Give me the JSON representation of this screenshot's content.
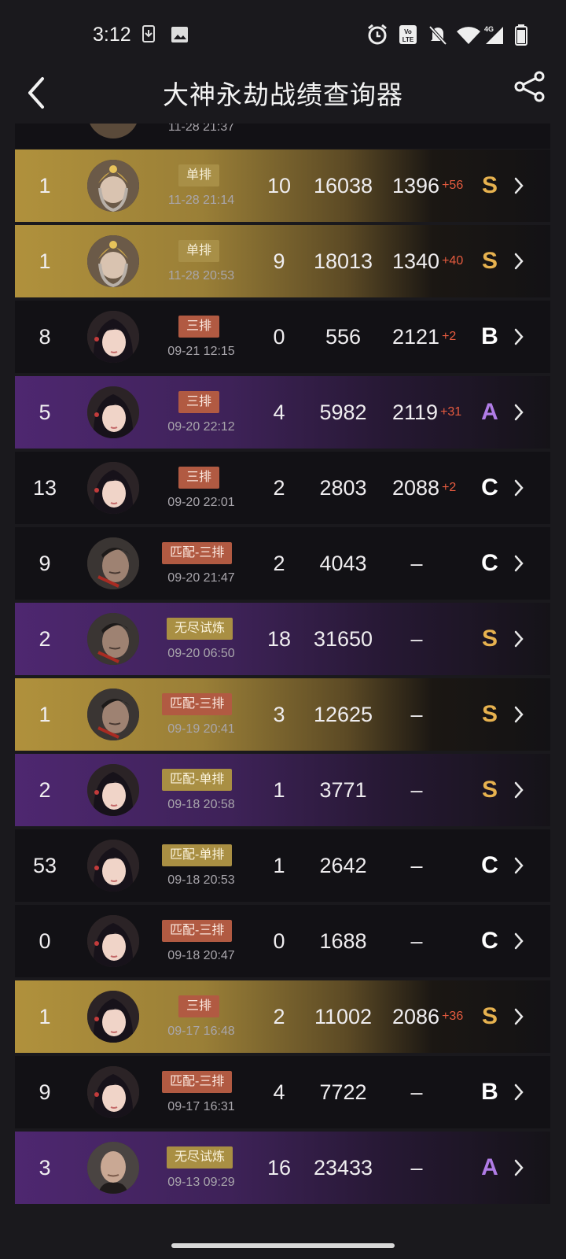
{
  "status_bar": {
    "time": "3:12",
    "icons": [
      "download-icon",
      "gallery-icon",
      "alarm-icon",
      "volte-icon",
      "mute-icon",
      "wifi-icon",
      "signal-4g-icon",
      "battery-icon"
    ],
    "network_label": "4G",
    "volte_label": "Vo LTE"
  },
  "header": {
    "title": "大神永劫战绩查询器"
  },
  "colors": {
    "gold_row": "#b0913c",
    "purple_row": "#4e2770",
    "dark_row": "#121115",
    "grade_s": "#e7b24f",
    "grade_a": "#b07ce6",
    "grade_bc": "#ffffff",
    "delta": "#e65b3f"
  },
  "partial_row": {
    "date": "11-28 21:37"
  },
  "matches": [
    {
      "rank": "1",
      "avatar": "warrior-crown",
      "mode": "单排",
      "mode_style": "gold",
      "date": "11-28 21:14",
      "kills": "10",
      "score": "16038",
      "rating": "1396",
      "delta": "+56",
      "grade": "S",
      "row_style": "gold"
    },
    {
      "rank": "1",
      "avatar": "warrior-crown",
      "mode": "单排",
      "mode_style": "gold",
      "date": "11-28 20:53",
      "kills": "9",
      "score": "18013",
      "rating": "1340",
      "delta": "+40",
      "grade": "S",
      "row_style": "gold"
    },
    {
      "rank": "8",
      "avatar": "girl",
      "mode": "三排",
      "mode_style": "red",
      "date": "09-21 12:15",
      "kills": "0",
      "score": "556",
      "rating": "2121",
      "delta": "+2",
      "grade": "B",
      "row_style": "dark"
    },
    {
      "rank": "5",
      "avatar": "girl",
      "mode": "三排",
      "mode_style": "red",
      "date": "09-20 22:12",
      "kills": "4",
      "score": "5982",
      "rating": "2119",
      "delta": "+31",
      "grade": "A",
      "row_style": "purple"
    },
    {
      "rank": "13",
      "avatar": "girl",
      "mode": "三排",
      "mode_style": "red",
      "date": "09-20 22:01",
      "kills": "2",
      "score": "2803",
      "rating": "2088",
      "delta": "+2",
      "grade": "C",
      "row_style": "dark"
    },
    {
      "rank": "9",
      "avatar": "man",
      "mode": "匹配-三排",
      "mode_style": "red",
      "date": "09-20 21:47",
      "kills": "2",
      "score": "4043",
      "rating": "–",
      "delta": "",
      "grade": "C",
      "row_style": "dark"
    },
    {
      "rank": "2",
      "avatar": "man",
      "mode": "无尽试炼",
      "mode_style": "olive",
      "date": "09-20 06:50",
      "kills": "18",
      "score": "31650",
      "rating": "–",
      "delta": "",
      "grade": "S",
      "row_style": "purple"
    },
    {
      "rank": "1",
      "avatar": "man",
      "mode": "匹配-三排",
      "mode_style": "red",
      "date": "09-19 20:41",
      "kills": "3",
      "score": "12625",
      "rating": "–",
      "delta": "",
      "grade": "S",
      "row_style": "gold"
    },
    {
      "rank": "2",
      "avatar": "girl",
      "mode": "匹配-单排",
      "mode_style": "olive",
      "date": "09-18 20:58",
      "kills": "1",
      "score": "3771",
      "rating": "–",
      "delta": "",
      "grade": "S",
      "row_style": "purple"
    },
    {
      "rank": "53",
      "avatar": "girl",
      "mode": "匹配-单排",
      "mode_style": "olive",
      "date": "09-18 20:53",
      "kills": "1",
      "score": "2642",
      "rating": "–",
      "delta": "",
      "grade": "C",
      "row_style": "dark"
    },
    {
      "rank": "0",
      "avatar": "girl",
      "mode": "匹配-三排",
      "mode_style": "red",
      "date": "09-18 20:47",
      "kills": "0",
      "score": "1688",
      "rating": "–",
      "delta": "",
      "grade": "C",
      "row_style": "dark"
    },
    {
      "rank": "1",
      "avatar": "girl",
      "mode": "三排",
      "mode_style": "red",
      "date": "09-17 16:48",
      "kills": "2",
      "score": "11002",
      "rating": "2086",
      "delta": "+36",
      "grade": "S",
      "row_style": "gold"
    },
    {
      "rank": "9",
      "avatar": "girl",
      "mode": "匹配-三排",
      "mode_style": "red",
      "date": "09-17 16:31",
      "kills": "4",
      "score": "7722",
      "rating": "–",
      "delta": "",
      "grade": "B",
      "row_style": "dark"
    },
    {
      "rank": "3",
      "avatar": "bald-man",
      "mode": "无尽试炼",
      "mode_style": "olive",
      "date": "09-13 09:29",
      "kills": "16",
      "score": "23433",
      "rating": "–",
      "delta": "",
      "grade": "A",
      "row_style": "purple"
    }
  ]
}
